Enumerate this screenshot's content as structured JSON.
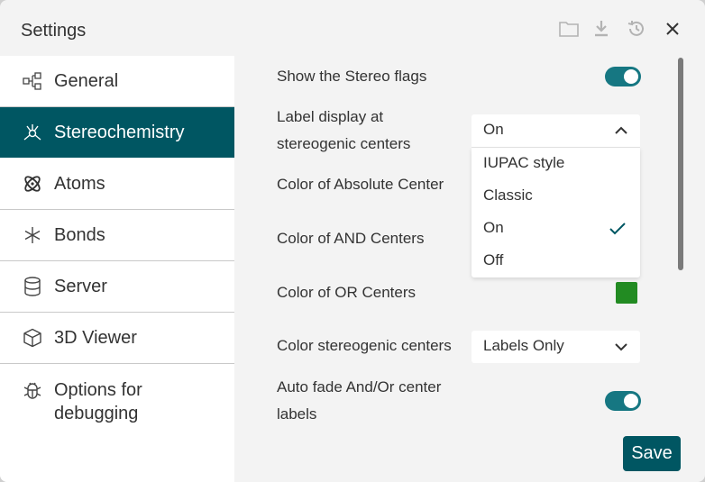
{
  "dialog": {
    "title": "Settings",
    "header_icons": [
      "folder-icon",
      "download-icon",
      "history-icon",
      "close-icon"
    ]
  },
  "sidebar": {
    "items": [
      {
        "label": "General",
        "icon": "hierarchy-icon",
        "active": false
      },
      {
        "label": "Stereochemistry",
        "icon": "stereo-atom-icon",
        "active": true
      },
      {
        "label": "Atoms",
        "icon": "atom-icon",
        "active": false
      },
      {
        "label": "Bonds",
        "icon": "asterisk-icon",
        "active": false
      },
      {
        "label": "Server",
        "icon": "database-icon",
        "active": false
      },
      {
        "label": "3D Viewer",
        "icon": "cube-icon",
        "active": false
      },
      {
        "label": "Options for debugging",
        "label_line1": "Options for",
        "label_line2": "debugging",
        "icon": "bug-icon",
        "active": false
      }
    ]
  },
  "settings": {
    "show_stereo_flags": {
      "label": "Show the Stereo flags",
      "enabled": true
    },
    "label_display": {
      "label_line1": "Label display at",
      "label_line2": "stereogenic centers",
      "value": "On",
      "options": [
        "IUPAC style",
        "Classic",
        "On",
        "Off"
      ],
      "selected": "On"
    },
    "color_absolute": {
      "label": "Color of Absolute Center"
    },
    "color_and": {
      "label": "Color of AND Centers"
    },
    "color_or": {
      "label": "Color of OR Centers",
      "color": "#228B22"
    },
    "color_stereogenic": {
      "label": "Color stereogenic centers",
      "value": "Labels Only"
    },
    "auto_fade": {
      "label_line1": "Auto fade And/Or center",
      "label_line2": "labels",
      "enabled": true
    }
  },
  "footer": {
    "save_label": "Save"
  },
  "colors": {
    "accent": "#005662",
    "toggle": "#167782"
  }
}
